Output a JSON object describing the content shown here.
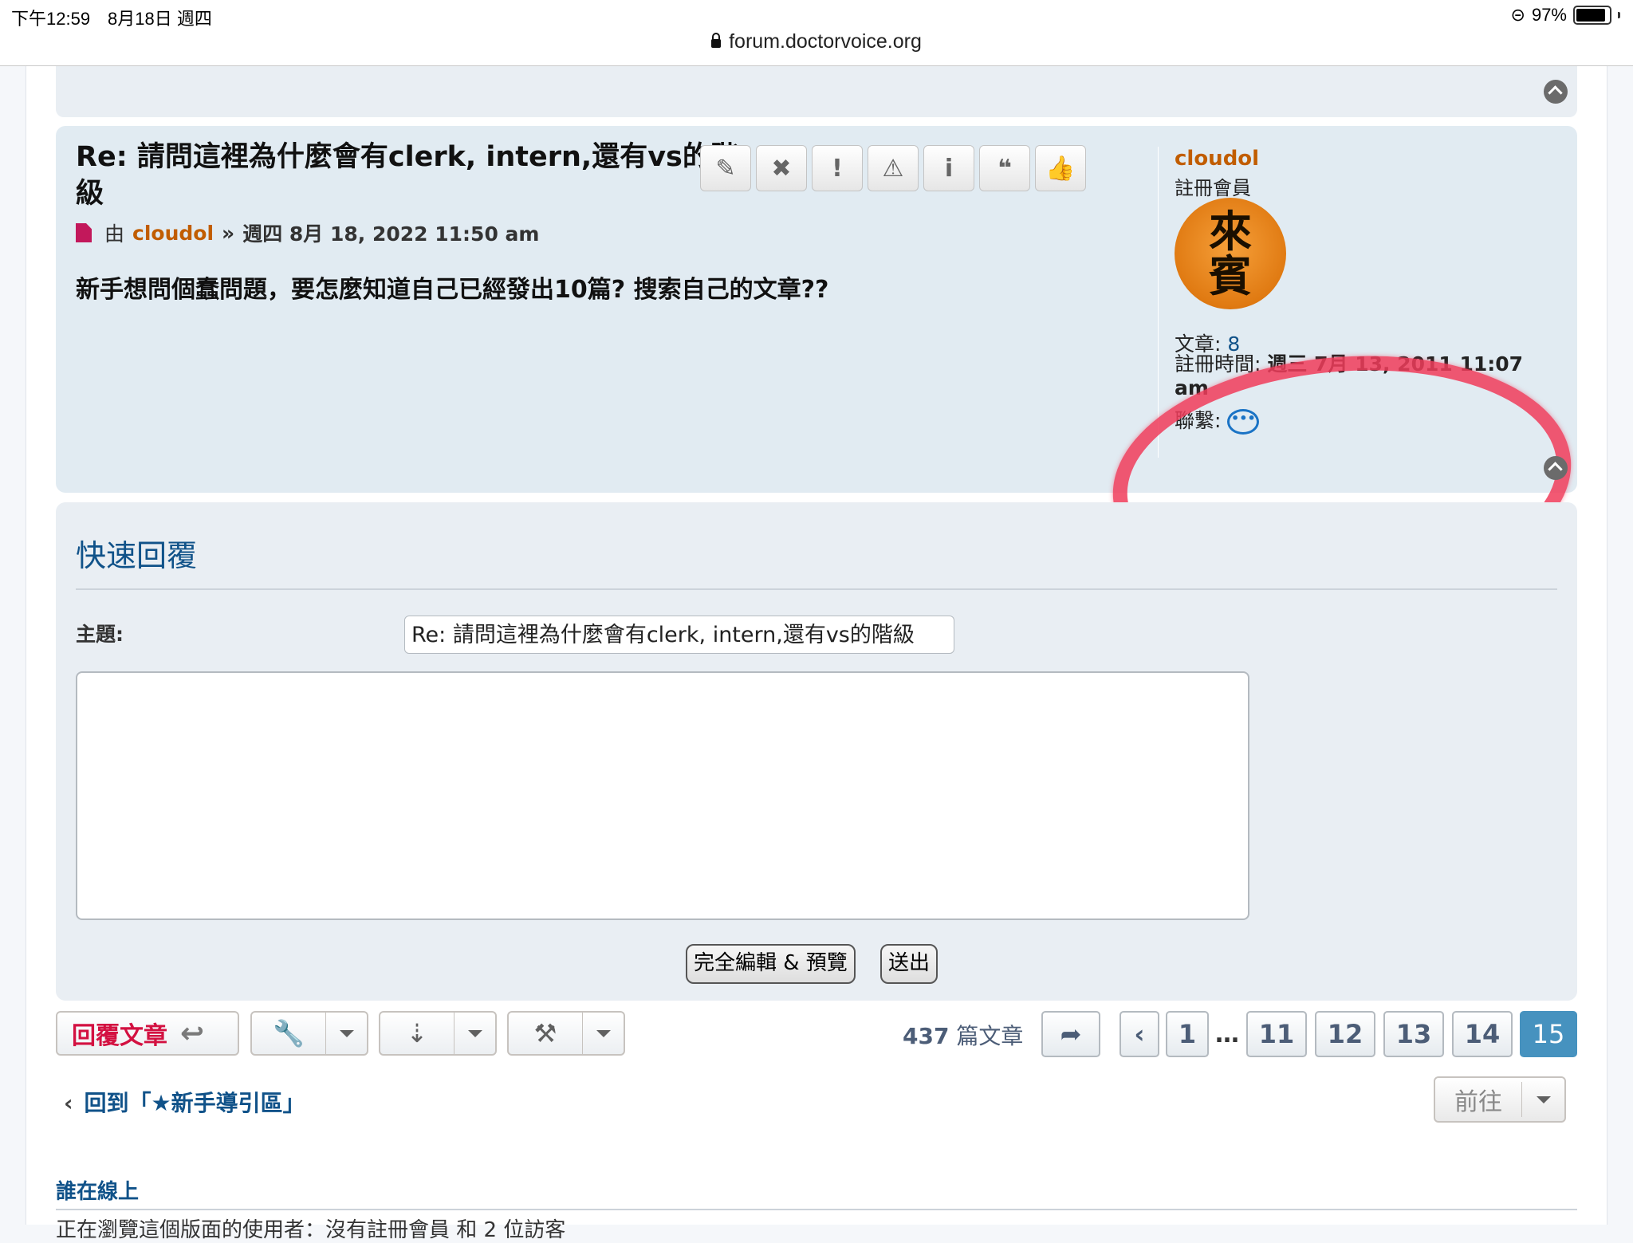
{
  "status_bar": {
    "time": "下午12:59　8月18日 週四",
    "battery": "97%",
    "url": "forum.doctorvoice.org"
  },
  "post": {
    "title": "Re: 請問這裡為什麼會有clerk, intern,還有vs的階級",
    "by": "由",
    "author": "cloudol",
    "sep": "»",
    "date": "週四 8月 18, 2022 11:50 am",
    "body": "新手想問個蠢問題，要怎麼知道自己已經發出10篇? 搜索自己的文章??",
    "actions": [
      "edit-icon",
      "delete-icon",
      "report-icon",
      "warn-icon",
      "info-icon",
      "quote-icon",
      "like-icon"
    ]
  },
  "profile": {
    "name": "cloudol",
    "rank": "註冊會員",
    "avatar_text": [
      "來",
      "賓"
    ],
    "posts_label": "文章:",
    "posts_value": "8",
    "joined_label": "註冊時間:",
    "joined_value": "週三 7月 13, 2011 11:07 am",
    "contact_label": "聯繫:"
  },
  "quick_reply": {
    "title": "快速回覆",
    "subject_label": "主題:",
    "subject_value": "Re: 請問這裡為什麼會有clerk, intern,還有vs的階級",
    "full_editor_label": "完全編輯 & 預覽",
    "submit_label": "送出"
  },
  "toolbar": {
    "reply_label": "回覆文章",
    "post_count": "437",
    "post_count_suffix": "篇文章"
  },
  "pagination": {
    "pages": [
      "1",
      "11",
      "12",
      "13",
      "14",
      "15"
    ],
    "current": "15",
    "ellipsis": "…"
  },
  "footer": {
    "back_label": "回到「★新手導引區」",
    "goto_label": "前往",
    "online_title": "誰在線上",
    "online_text": "正在瀏覽這個版面的使用者：沒有註冊會員 和 2 位訪客"
  },
  "colors": {
    "accent": "#105289",
    "author": "#c15d00",
    "reply": "#d31141",
    "active_page": "#4692bf",
    "annotation": "#f03c5a"
  }
}
